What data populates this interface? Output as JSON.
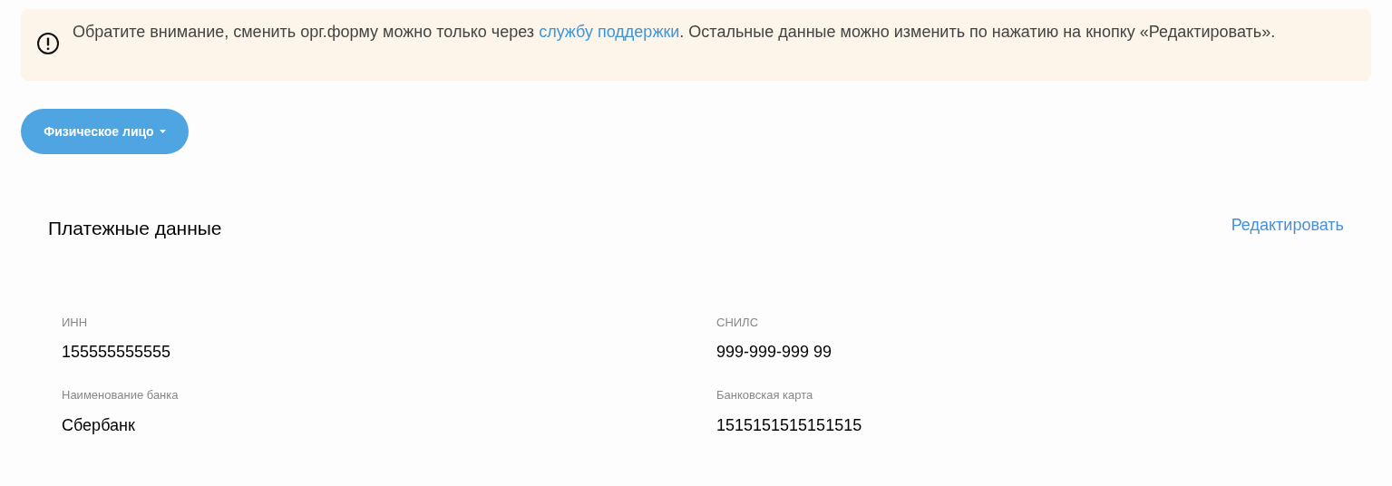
{
  "notice": {
    "text_before": "Обратите внимание, сменить орг.форму можно только через ",
    "link": "службу поддержки",
    "text_after": ". Остальные данные можно изменить по нажатию на кнопку «Редактировать»."
  },
  "type_dropdown": {
    "label": "Физическое лицо"
  },
  "section": {
    "title": "Платежные данные",
    "edit_link": "Редактировать",
    "fields": [
      {
        "label": "ИНН",
        "value": "155555555555"
      },
      {
        "label": "СНИЛС",
        "value": "999-999-999 99"
      },
      {
        "label": "Наименование банка",
        "value": "Сбербанк"
      },
      {
        "label": "Банковская карта",
        "value": "1515151515151515"
      }
    ]
  }
}
